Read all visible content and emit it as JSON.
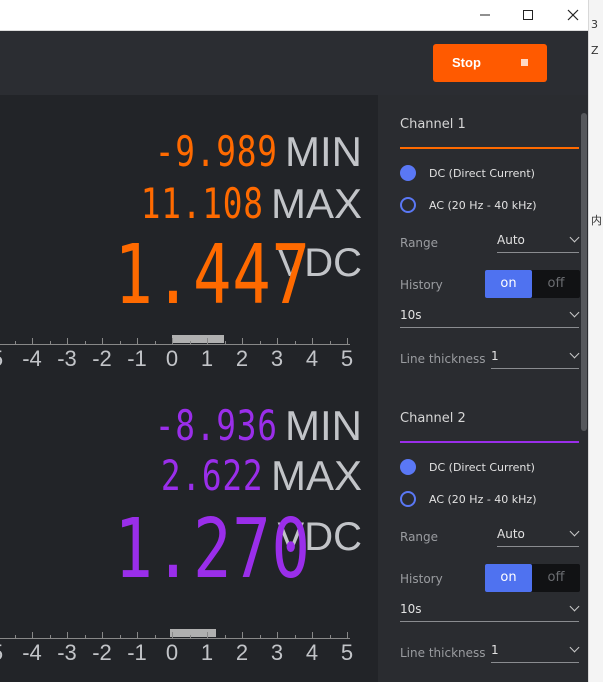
{
  "window": {
    "minimize_icon": "minimize-icon",
    "maximize_icon": "maximize-icon",
    "close_icon": "close-icon"
  },
  "edge_text": {
    "top": "3",
    "letter": "Z",
    "mid": "内"
  },
  "toolbar": {
    "stop_label": "Stop",
    "stop_icon": "stop-square-icon"
  },
  "channels": [
    {
      "meter": {
        "min_value": "-9.989",
        "min_label": "MIN",
        "max_value": "11.108",
        "max_label": "MAX",
        "value": "1.447",
        "unit": "VDC",
        "color": "#ff6a00",
        "scale_labels": [
          "5",
          "-4",
          "-3",
          "-2",
          "-1",
          "0",
          "1",
          "2",
          "3",
          "4",
          "5"
        ]
      },
      "panel": {
        "title": "Channel 1",
        "accent": "#ff6a00",
        "dc_label": "DC (Direct Current)",
        "ac_label": "AC (20 Hz - 40 kHz)",
        "range_label": "Range",
        "range_value": "Auto",
        "history_label": "History",
        "history_on": "on",
        "history_off": "off",
        "history_value": "10s",
        "thickness_label": "Line thickness",
        "thickness_value": "1"
      }
    },
    {
      "meter": {
        "min_value": "-8.936",
        "min_label": "MIN",
        "max_value": "2.622",
        "max_label": "MAX",
        "value": "1.270",
        "unit": "VDC",
        "color": "#9a2eea",
        "scale_labels": [
          "5",
          "-4",
          "-3",
          "-2",
          "-1",
          "0",
          "1",
          "2",
          "3",
          "4",
          "5"
        ]
      },
      "panel": {
        "title": "Channel 2",
        "accent": "#9a2eea",
        "dc_label": "DC (Direct Current)",
        "ac_label": "AC (20 Hz - 40 kHz)",
        "range_label": "Range",
        "range_value": "Auto",
        "history_label": "History",
        "history_on": "on",
        "history_off": "off",
        "history_value": "10s",
        "thickness_label": "Line thickness",
        "thickness_value": "1"
      }
    }
  ]
}
